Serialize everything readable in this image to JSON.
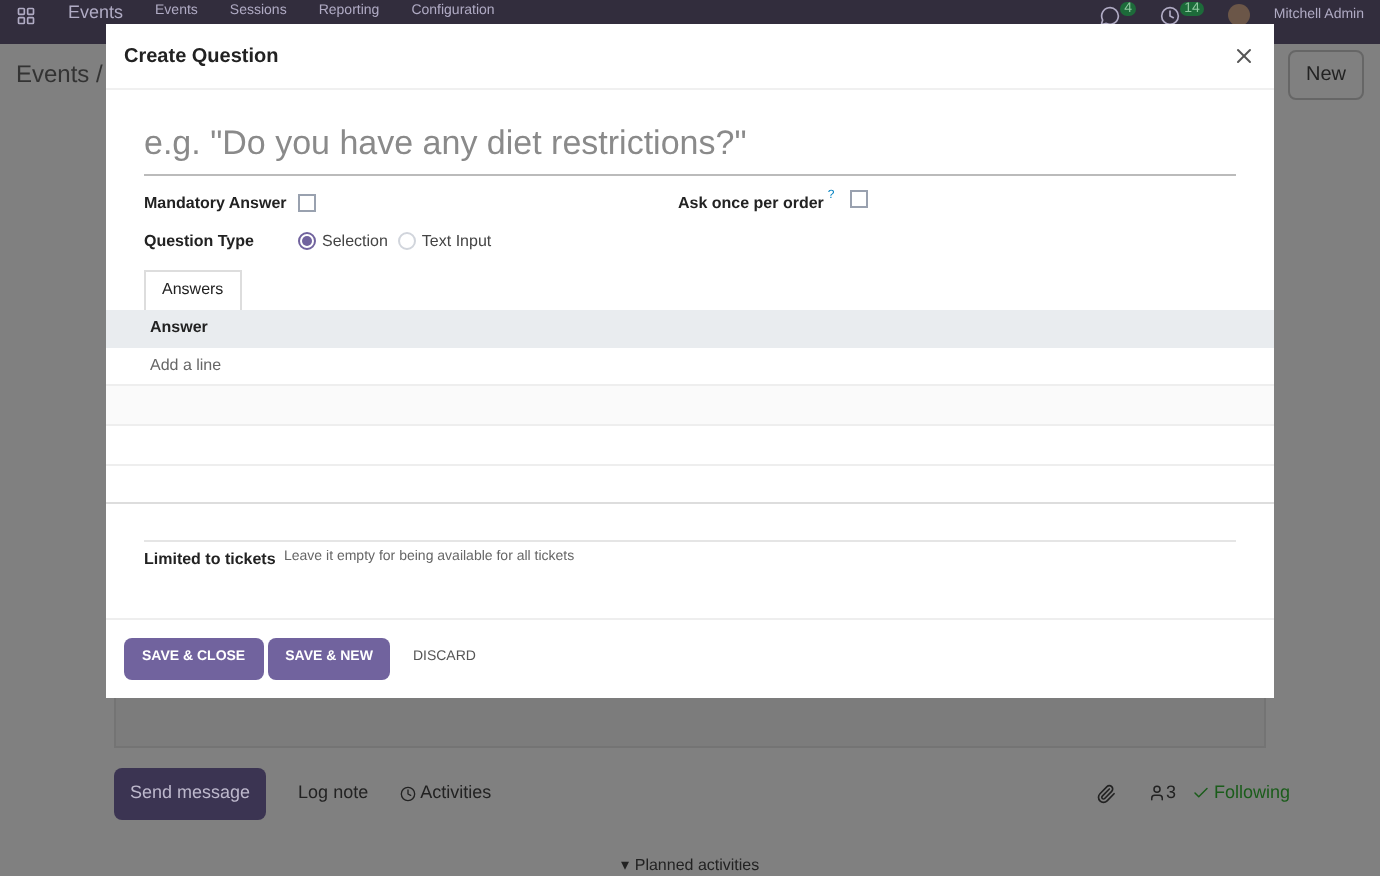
{
  "navbar": {
    "app": "Events",
    "menu": [
      "Events",
      "Sessions",
      "Reporting",
      "Configuration"
    ],
    "chat_count": "4",
    "activity_count": "14",
    "user": "Mitchell Admin"
  },
  "breadcrumb": "Events /",
  "new_button": "New",
  "dialog": {
    "title": "Create Question",
    "question_placeholder": "e.g. \"Do you have any diet restrictions?\"",
    "mandatory": {
      "label": "Mandatory Answer",
      "checked": false
    },
    "once_per_order": {
      "label": "Ask once per order",
      "help": "?",
      "checked": false
    },
    "question_type": {
      "label": "Question Type",
      "options": [
        {
          "label": "Selection",
          "selected": true
        },
        {
          "label": "Text Input",
          "selected": false
        }
      ]
    },
    "tabs": [
      {
        "label": "Answers",
        "selected": true
      }
    ],
    "answers": {
      "column": "Answer",
      "add_line": "Add a line"
    },
    "limited_to_tickets": {
      "label": "Limited to tickets",
      "placeholder": "Leave it empty for being available for all tickets"
    },
    "buttons": [
      {
        "label": "SAVE & CLOSE",
        "kind": "primary"
      },
      {
        "label": "SAVE & NEW",
        "kind": "primary"
      },
      {
        "label": "DISCARD",
        "kind": "link"
      }
    ]
  },
  "chatter": {
    "send_message": "Send message",
    "log_note": "Log note",
    "activities": "Activities",
    "followers": "3",
    "following": "Following",
    "planned_caret": "▾",
    "planned": "Planned activities"
  }
}
